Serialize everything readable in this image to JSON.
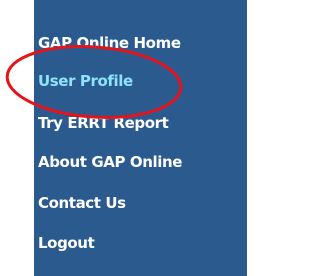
{
  "nav": {
    "items": [
      {
        "label": "GAP Online Home"
      },
      {
        "label": "User Profile",
        "active": true
      },
      {
        "label": "Try ERRT Report"
      },
      {
        "label": "About GAP Online"
      },
      {
        "label": "Contact Us"
      },
      {
        "label": "Logout"
      }
    ]
  },
  "colors": {
    "panel_background": "#2b5a8e",
    "link_text": "#ffffff",
    "active_link_text": "#8fe3ff",
    "annotation_circle": "#e5131b"
  },
  "annotation": {
    "shape": "ellipse",
    "highlights": "User Profile"
  }
}
